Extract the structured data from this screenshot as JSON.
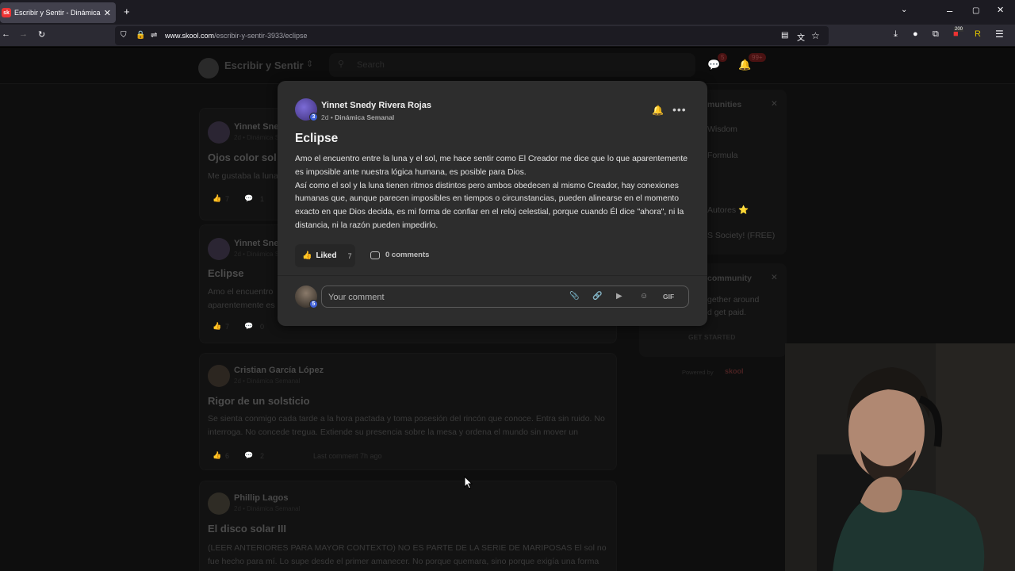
{
  "browser": {
    "tab_title": "Escribir y Sentir - Dinámica Sem",
    "tab_favicon": "sk",
    "url_host": "www.skool.com",
    "url_path": "/escribir-y-sentir-3933/eclipse",
    "extension_badge": "200"
  },
  "group": {
    "name": "Escribir y Sentir",
    "search_placeholder": "Search",
    "chat_badge": "5",
    "notif_badge": "99+"
  },
  "feed": [
    {
      "author": "Yinnet Sned",
      "meta": "2d • Dinámica Semanal",
      "title": "Ojos color sol",
      "body": "Me gustaba la luna",
      "likes": "7",
      "comments": "1"
    },
    {
      "author": "Yinnet Sned",
      "meta": "2d • Dinámica Semanal",
      "title": "Eclipse",
      "body": "Amo el encuentro\naparentemente es",
      "likes": "7",
      "comments": "0"
    },
    {
      "author": "Cristian García López",
      "meta": "2d • Dinámica Semanal",
      "title": "Rigor de un solsticio",
      "body": "Se sienta conmigo cada tarde a la hora pactada y toma posesión del rincón que conoce. Entra sin ruido. No interroga. No concede tregua. Extiende su presencia sobre la mesa y ordena el mundo sin mover un",
      "likes": "6",
      "comments": "2",
      "last_comment": "Last comment 7h ago"
    },
    {
      "author": "Phillip Lagos",
      "meta": "2d • Dinámica Semanal",
      "title": "El disco solar III",
      "body": "(LEER ANTERIORES PARA MAYOR CONTEXTO) NO ES PARTE DE LA SERIE DE MARIPOSAS El sol no fue hecho para mí. Lo supe desde el primer amanecer. No porque quemara, sino porque exigía una forma"
    }
  ],
  "sidebar": {
    "communities_title": "munities",
    "items": [
      "Wisdom",
      "Formula",
      "Autores ⭐",
      "S Society! (FREE)"
    ],
    "create_title": "community",
    "create_text": "gether around\nd get paid.",
    "get_started": "GET STARTED",
    "powered_by": "Powered by",
    "skool_logo": "skool"
  },
  "post": {
    "author": "Yinnet Snedy Rivera Rojas",
    "author_level": "3",
    "time": "2d",
    "category": "Dinámica Semanal",
    "title": "Eclipse",
    "paragraphs": [
      "Amo el encuentro entre la luna y el sol, me hace sentir como El Creador me dice que lo que aparentemente es imposible ante nuestra lógica humana, es posible para Dios.",
      "Así como el sol y la luna tienen ritmos distintos pero ambos obedecen al mismo Creador, hay conexiones humanas que, aunque parecen imposibles en tiempos o circunstancias, pueden alinearse en el momento exacto en que Dios decida, es mi forma de confiar en el reloj celestial, porque cuando Él dice \"ahora\", ni la distancia, ni la razón pueden impedirlo."
    ],
    "like_label": "Liked",
    "like_count": "7",
    "comments_label": "0 comments"
  },
  "comment": {
    "placeholder": "Your comment",
    "user_level": "5",
    "gif_label": "GIF"
  },
  "colors": {
    "modal_bg": "#2d2d2d",
    "like_accent": "#f5c542",
    "level_badge": "#3e5fd6"
  }
}
